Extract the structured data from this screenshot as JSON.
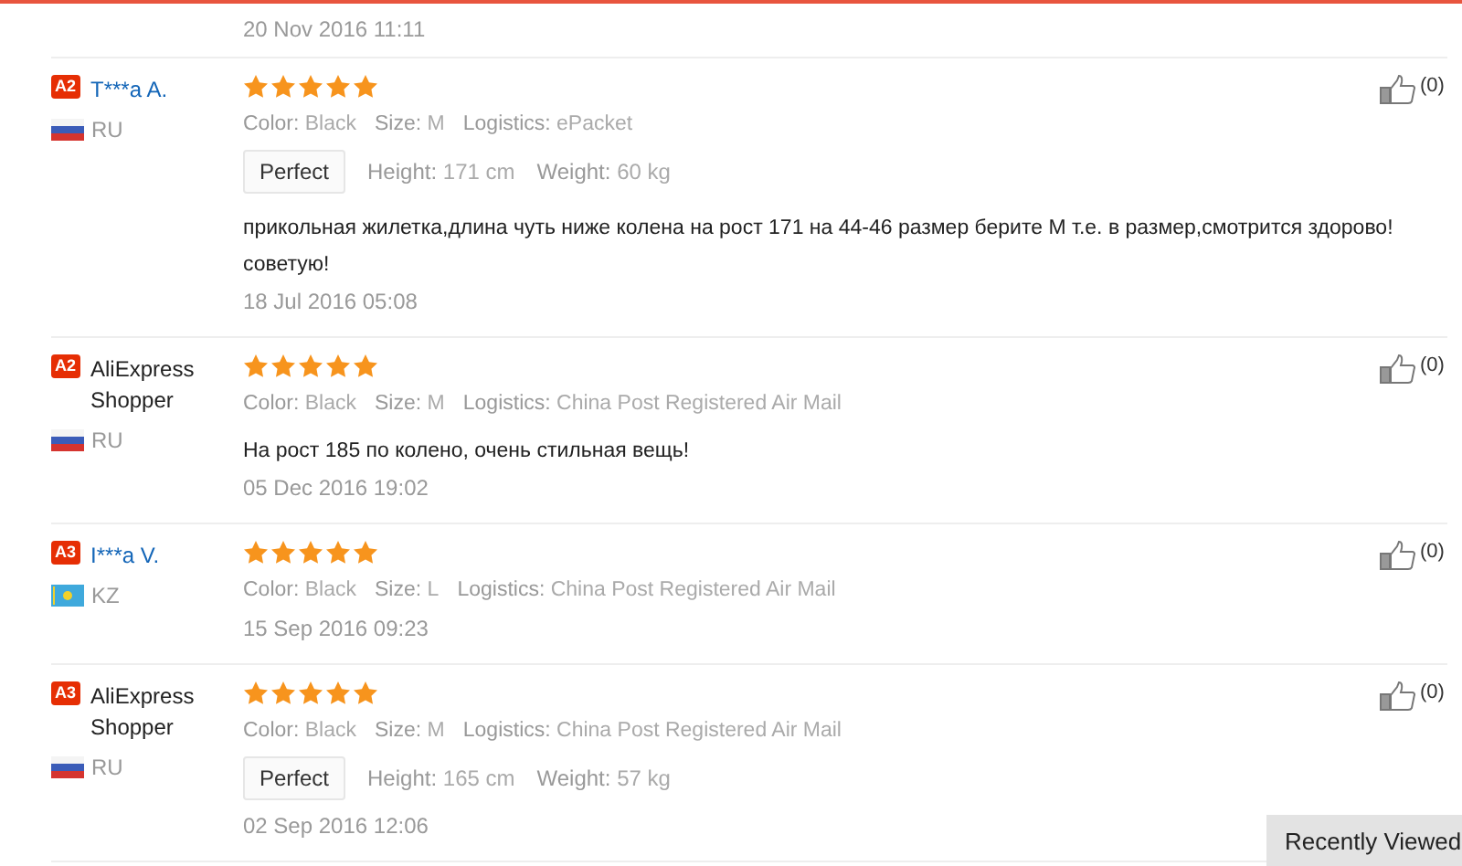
{
  "previous_review": {
    "date": "20 Nov 2016 11:11"
  },
  "reviews": [
    {
      "badge": "A2",
      "name": {
        "text": "T***a A.",
        "kind": "link"
      },
      "country": {
        "code": "RU",
        "kind": "tricolor"
      },
      "stars": 5,
      "attributes": [
        {
          "label": "Color:",
          "value": "Black"
        },
        {
          "label": "Size:",
          "value": "M"
        },
        {
          "label": "Logistics:",
          "value": "ePacket"
        }
      ],
      "fit": {
        "tag": "Perfect",
        "measures": [
          {
            "label": "Height:",
            "value": "171 cm"
          },
          {
            "label": "Weight:",
            "value": "60 kg"
          }
        ]
      },
      "comment": "прикольная жилетка,длина чуть ниже колена на рост 171 на 44-46 размер берите М т.е. в размер,смотрится здорово! советую!",
      "date": "18 Jul 2016 05:08",
      "likes": "(0)"
    },
    {
      "badge": "A2",
      "name": {
        "text": "AliExpress Shopper",
        "kind": "plain"
      },
      "country": {
        "code": "RU",
        "kind": "tricolor"
      },
      "stars": 5,
      "attributes": [
        {
          "label": "Color:",
          "value": "Black"
        },
        {
          "label": "Size:",
          "value": "M"
        },
        {
          "label": "Logistics:",
          "value": "China Post Registered Air Mail"
        }
      ],
      "comment": "На рост 185 по колено, очень стильная вещь!",
      "date": "05 Dec 2016 19:02",
      "likes": "(0)"
    },
    {
      "badge": "A3",
      "name": {
        "text": "I***a V.",
        "kind": "link"
      },
      "country": {
        "code": "KZ",
        "kind": "emblem"
      },
      "stars": 5,
      "attributes": [
        {
          "label": "Color:",
          "value": "Black"
        },
        {
          "label": "Size:",
          "value": "L"
        },
        {
          "label": "Logistics:",
          "value": "China Post Registered Air Mail"
        }
      ],
      "date": "15 Sep 2016 09:23",
      "likes": "(0)"
    },
    {
      "badge": "A3",
      "name": {
        "text": "AliExpress Shopper",
        "kind": "plain"
      },
      "country": {
        "code": "RU",
        "kind": "tricolor"
      },
      "stars": 5,
      "attributes": [
        {
          "label": "Color:",
          "value": "Black"
        },
        {
          "label": "Size:",
          "value": "M"
        },
        {
          "label": "Logistics:",
          "value": "China Post Registered Air Mail"
        }
      ],
      "fit": {
        "tag": "Perfect",
        "measures": [
          {
            "label": "Height:",
            "value": "165 cm"
          },
          {
            "label": "Weight:",
            "value": "57 kg"
          }
        ]
      },
      "date": "02 Sep 2016 12:06",
      "likes": "(0)"
    }
  ],
  "recently_viewed": {
    "label": "Recently Viewed"
  }
}
